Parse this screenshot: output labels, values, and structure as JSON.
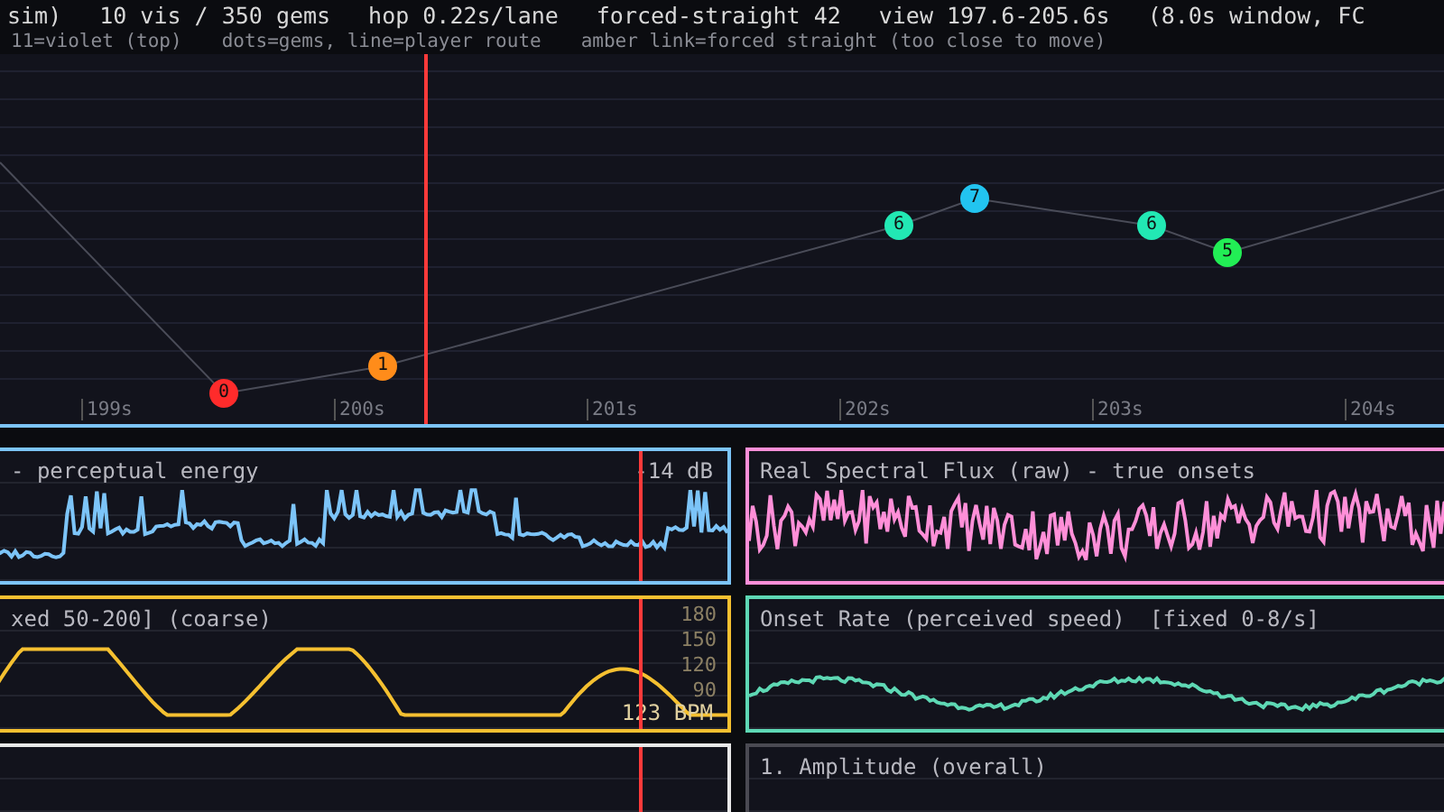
{
  "header": {
    "stats": [
      "sim)",
      "10 vis / 350 gems",
      "hop 0.22s/lane",
      "forced-straight 42",
      "view 197.6-205.6s",
      "(8.0s window, FC"
    ],
    "legend": [
      "11=violet (top)",
      "dots=gems, line=player route",
      "amber link=forced straight (too close to move)"
    ]
  },
  "track": {
    "gems": [
      {
        "label": "0",
        "color": "#ff2b2b"
      },
      {
        "label": "1",
        "color": "#ff8c1a"
      },
      {
        "label": "6",
        "color": "#22e8b4"
      },
      {
        "label": "7",
        "color": "#22c4f0"
      },
      {
        "label": "6",
        "color": "#22e8b4"
      },
      {
        "label": "5",
        "color": "#22ee55"
      }
    ],
    "ticks": [
      "199s",
      "200s",
      "201s",
      "202s",
      "203s",
      "204s"
    ]
  },
  "panels": [
    {
      "kind": "energy",
      "title": "- perceptual energy",
      "readout": "-14 dB",
      "color": "#7cc4f8"
    },
    {
      "kind": "flux",
      "title": "Real Spectral Flux (raw) - true onsets",
      "color": "#ff8fd8"
    },
    {
      "kind": "tempo",
      "title": "xed 50-200] (coarse)",
      "readout": "123 BPM",
      "ticks": [
        "180",
        "150",
        "120",
        "90"
      ],
      "color": "#f5c030"
    },
    {
      "kind": "rate",
      "title": "Onset Rate (perceived speed)",
      "note": "[fixed 0-8/s]",
      "color": "#5ed8b4"
    },
    {
      "kind": "blank",
      "color": "#e8e8e8"
    },
    {
      "kind": "amplitude",
      "title": "1. Amplitude (overall)",
      "color": "#4a4a52"
    }
  ]
}
